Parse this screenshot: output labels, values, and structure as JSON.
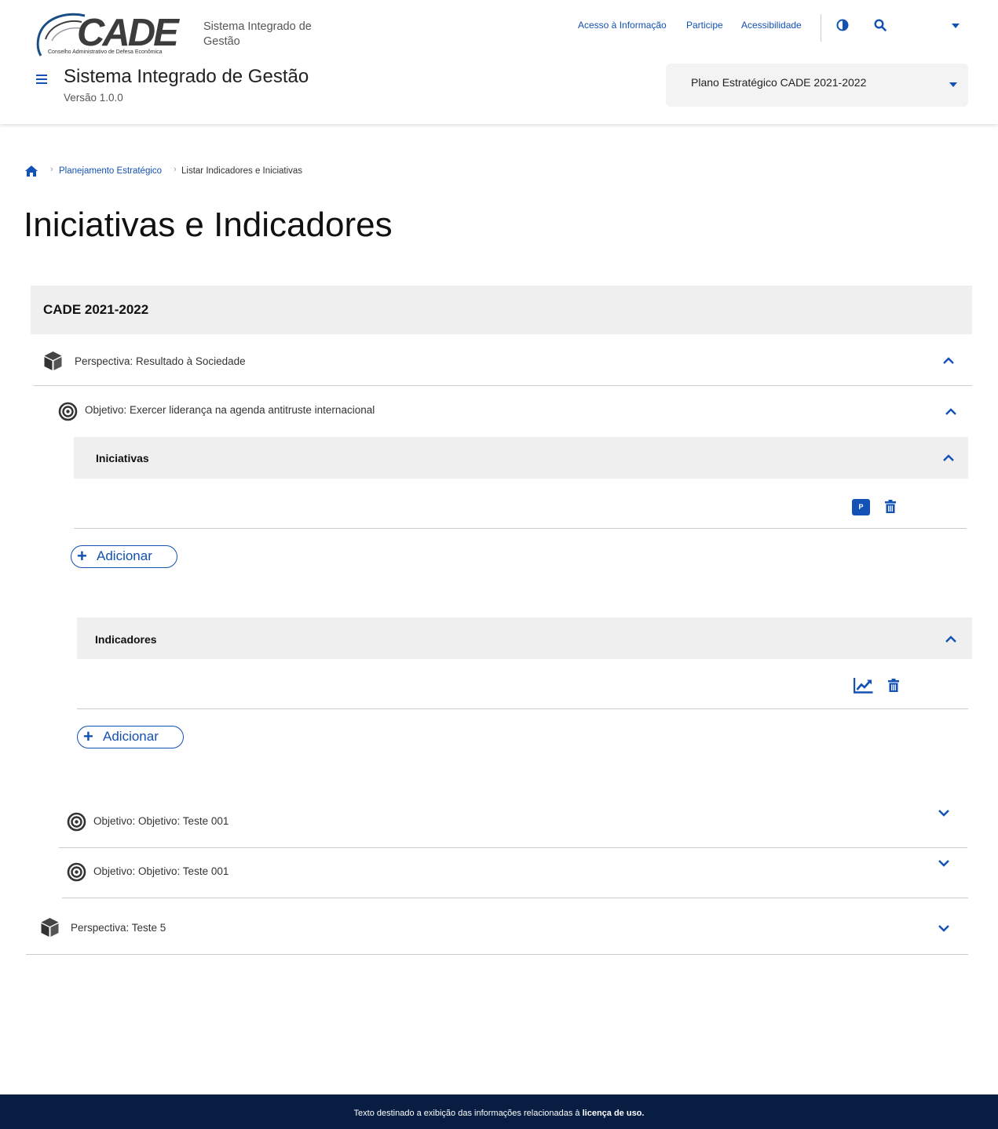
{
  "header": {
    "logo_text": "CADE",
    "logo_subtitle": "Conselho Administrativo de Defesa Econômica",
    "system_subtitle": "Sistema Integrado de Gestão",
    "links": [
      "Acesso à Informação",
      "Participe",
      "Acessibilidade"
    ],
    "app_title": "Sistema Integrado de Gestão",
    "app_version": "Versão 1.0.0",
    "plan_select_value": "Plano Estratégico CADE 2021-2022",
    "icons": [
      "contrast-icon",
      "search-icon",
      "caret-down-icon",
      "menu-icon"
    ],
    "accent_color": "#1351b4"
  },
  "breadcrumb": {
    "home_icon": "home-icon",
    "items": [
      "Planejamento Estratégico",
      "Listar Indicadores e Iniciativas"
    ]
  },
  "page": {
    "title": "Iniciativas e Indicadores",
    "plan_label": "CADE 2021-2022",
    "perspectives": [
      {
        "label": "Perspectiva: Resultado à Sociedade",
        "expanded": true,
        "objectives": [
          {
            "label": "Objetivo: Exercer liderança na agenda antitruste internacional",
            "expanded": true,
            "iniciativas_label": "Iniciativas",
            "iniciativas_badge": "P",
            "indicadores_label": "Indicadores",
            "add_label": "Adicionar"
          },
          {
            "label": "Objetivo: Objetivo:  Teste 001",
            "expanded": false
          },
          {
            "label": "Objetivo: Objetivo:  Teste 001",
            "expanded": false
          }
        ]
      },
      {
        "label": "Perspectiva: Teste 5",
        "expanded": false
      }
    ]
  },
  "footer": {
    "text": "Texto destinado a exibição das informações relacionadas à",
    "link": "licença de uso.",
    "background": "#071d41"
  }
}
